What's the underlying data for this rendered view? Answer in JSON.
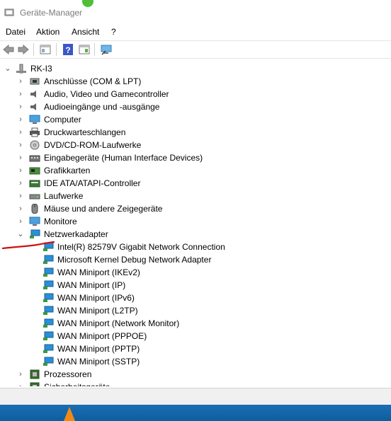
{
  "window": {
    "title": "Geräte-Manager"
  },
  "menu": [
    "Datei",
    "Aktion",
    "Ansicht",
    "?"
  ],
  "tree": {
    "root": "RK-I3",
    "categories": [
      {
        "label": "Anschlüsse (COM & LPT)",
        "icon": "port-icon"
      },
      {
        "label": "Audio, Video und Gamecontroller",
        "icon": "speaker-icon"
      },
      {
        "label": "Audioeingänge und -ausgänge",
        "icon": "speaker-icon"
      },
      {
        "label": "Computer",
        "icon": "computer-icon"
      },
      {
        "label": "Druckwarteschlangen",
        "icon": "printer-icon"
      },
      {
        "label": "DVD/CD-ROM-Laufwerke",
        "icon": "dvd-icon"
      },
      {
        "label": "Eingabegeräte (Human Interface Devices)",
        "icon": "keyboard-icon"
      },
      {
        "label": "Grafikkarten",
        "icon": "gpu-icon"
      },
      {
        "label": "IDE ATA/ATAPI-Controller",
        "icon": "ide-icon"
      },
      {
        "label": "Laufwerke",
        "icon": "drive-icon"
      },
      {
        "label": "Mäuse und andere Zeigegeräte",
        "icon": "mouse-icon"
      },
      {
        "label": "Monitore",
        "icon": "monitor-icon"
      },
      {
        "label": "Netzwerkadapter",
        "icon": "network-icon",
        "expanded": true
      }
    ],
    "network_adapters": [
      "Intel(R) 82579V Gigabit Network Connection",
      "Microsoft Kernel Debug Network Adapter",
      "WAN Miniport (IKEv2)",
      "WAN Miniport (IP)",
      "WAN Miniport (IPv6)",
      "WAN Miniport (L2TP)",
      "WAN Miniport (Network Monitor)",
      "WAN Miniport (PPPOE)",
      "WAN Miniport (PPTP)",
      "WAN Miniport (SSTP)"
    ],
    "after": [
      {
        "label": "Prozessoren",
        "icon": "cpu-icon"
      },
      {
        "label": "Sicherheitsgeräte",
        "icon": "security-icon"
      }
    ]
  },
  "colors": {
    "annotation": "#d01010",
    "taskbar": "#0d5e9e",
    "network_icon": "#2a8fd6"
  }
}
